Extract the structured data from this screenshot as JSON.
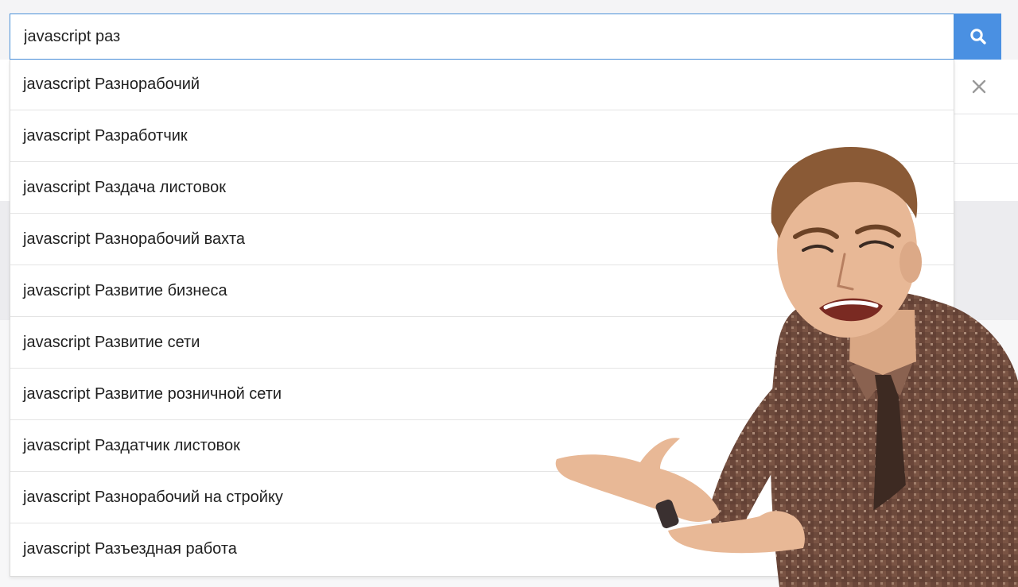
{
  "search": {
    "value": "javascript раз"
  },
  "suggestions": [
    "javascript Разнорабочий",
    "javascript Разработчик",
    "javascript Раздача листовок",
    "javascript Разнорабочий вахта",
    "javascript Развитие бизнеса",
    "javascript Развитие сети",
    "javascript Развитие розничной сети",
    "javascript Раздатчик листовок",
    "javascript Разнорабочий на стройку",
    "javascript Разъездная работа"
  ],
  "icons": {
    "search_button": "search-icon",
    "close": "close-icon"
  },
  "colors": {
    "accent": "#4a90e2",
    "input_border": "#4a90d9",
    "shirt": "#6e4a3a",
    "tie": "#3d2a22",
    "hair": "#8a5a36",
    "skin": "#e8b896"
  }
}
